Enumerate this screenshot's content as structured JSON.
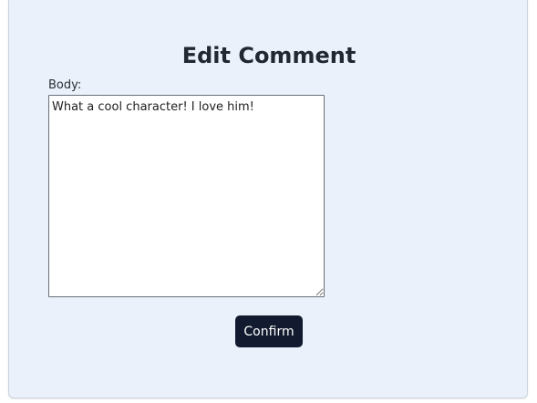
{
  "form": {
    "title": "Edit Comment",
    "body_label": "Body:",
    "body_value": "What a cool character! I love him!",
    "confirm_label": "Confirm"
  }
}
